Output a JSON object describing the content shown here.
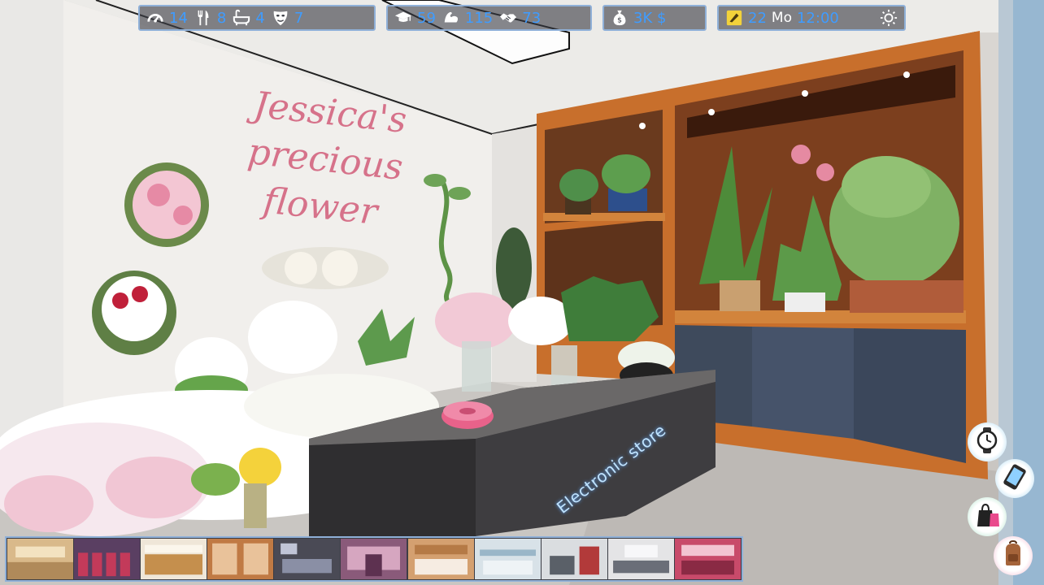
{
  "scene": {
    "sign_lines": [
      "Jessica's",
      "precious",
      "flower"
    ],
    "counter_label": "Electronic store"
  },
  "hud": {
    "needs": [
      {
        "icon": "gauge-icon",
        "value": "14"
      },
      {
        "icon": "fork-knife-icon",
        "value": "8"
      },
      {
        "icon": "bathtub-icon",
        "value": "4"
      },
      {
        "icon": "mask-icon",
        "value": "7"
      }
    ],
    "skills": [
      {
        "icon": "graduation-cap-icon",
        "value": "59"
      },
      {
        "icon": "muscle-arm-icon",
        "value": "115"
      },
      {
        "icon": "handshake-icon",
        "value": "73"
      }
    ],
    "money": {
      "icon": "money-bag-icon",
      "value": "3K $"
    },
    "time": {
      "icon": "calendar-icon",
      "date": "22",
      "weekday": "Mo",
      "clock": "12:00",
      "weather_icon": "sun-icon"
    }
  },
  "side_buttons": [
    {
      "name": "watch-button",
      "icon": "wristwatch-icon"
    },
    {
      "name": "phone-button",
      "icon": "smartphone-icon"
    },
    {
      "name": "shopping-bag-button",
      "icon": "shopping-bag-icon"
    },
    {
      "name": "backpack-button",
      "icon": "backpack-icon"
    }
  ],
  "location_strip": {
    "thumbnails": [
      "mall-hall",
      "arcade",
      "bakery",
      "bookstore",
      "furniture-store",
      "clothing-store",
      "bedding-store",
      "electronics-store",
      "office",
      "jewelry-store",
      "toy-store"
    ]
  },
  "colors": {
    "hud_number": "#3f9cff",
    "hud_border": "#8fb0d8",
    "sign_pink": "#d6728a",
    "counter_label_glow": "#5fa8ff"
  }
}
